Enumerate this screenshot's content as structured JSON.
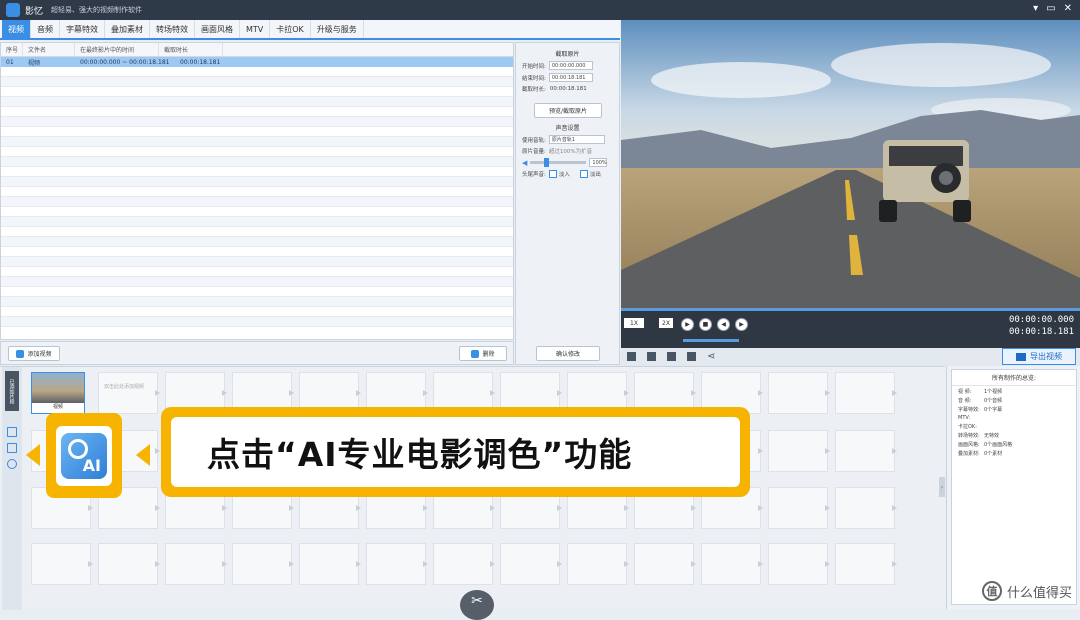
{
  "app": {
    "name": "影忆",
    "slogan": "超轻易、强大的视频制作软件",
    "window_controls": [
      "▾",
      "▭",
      "✕"
    ]
  },
  "tabs": [
    "视频",
    "音频",
    "字幕特效",
    "叠加素材",
    "转场特效",
    "画面风格",
    "MTV",
    "卡拉OK",
    "升级与服务"
  ],
  "filelist": {
    "columns": [
      "序号",
      "文件名",
      "在最终影片中的时间",
      "截取时长"
    ],
    "rows": [
      {
        "num": "01",
        "name": "视频",
        "range": "00:00:00.000 ~ 00:00:18.181",
        "dur": "00:00:18.181"
      }
    ]
  },
  "buttons": {
    "add_video": "添加视频",
    "delete": "删除",
    "confirm": "确认修改",
    "preview_clip": "预览/截取原片",
    "export": "导出视频"
  },
  "props": {
    "title1": "截取原片",
    "start_label": "开始时间:",
    "start_val": "00:00:00.000",
    "end_label": "结束时间:",
    "end_val": "00:00:18.181",
    "dur_label": "截取时长:",
    "dur_val": "00:00:18.181",
    "title2": "声音设置",
    "track_label": "使用音轨:",
    "track_val": "原片音轨1",
    "vol_label": "原片音量:",
    "vol_hint": "超过100%为扩音",
    "vol_val": "100%",
    "fade_label": "头尾声音:",
    "fade_in": "淡入",
    "fade_out": "淡出"
  },
  "player": {
    "time_current": "00:00:00.000",
    "time_total": "00:00:18.181",
    "speed": "1X",
    "zoom": "2X"
  },
  "timeline": {
    "side_label": "已添加片段",
    "clip_caption": "视频",
    "empty_hint": "双击此处添加视频"
  },
  "info": {
    "title": "所有制作的总览:",
    "rows": [
      {
        "k": "视 频:",
        "v": "1个视频"
      },
      {
        "k": "音 频:",
        "v": "0个音频"
      },
      {
        "k": "字幕特效:",
        "v": "0个字幕"
      },
      {
        "k": "MTV:",
        "v": ""
      },
      {
        "k": "卡拉OK:",
        "v": ""
      },
      {
        "k": "转场特效:",
        "v": "无特效"
      },
      {
        "k": "画面风格:",
        "v": "0个画面风格"
      },
      {
        "k": "叠加素材:",
        "v": "0个素材"
      }
    ]
  },
  "callout": {
    "text": "点击“AI专业电影调色”功能",
    "icon_text": "AI"
  },
  "watermark": {
    "text": "什么值得买",
    "icon": "值"
  }
}
